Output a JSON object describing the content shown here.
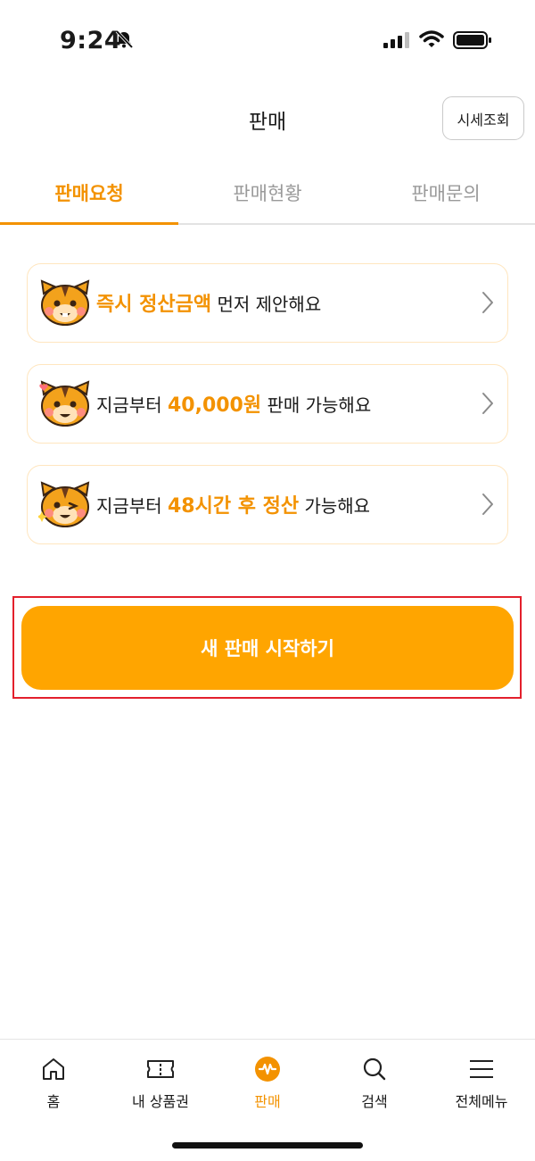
{
  "status_bar": {
    "time": "9:24"
  },
  "header": {
    "title": "판매",
    "price_check_label": "시세조회"
  },
  "tabs": [
    {
      "label": "판매요청",
      "active": true
    },
    {
      "label": "판매현황",
      "active": false
    },
    {
      "label": "판매문의",
      "active": false
    }
  ],
  "cards": [
    {
      "highlight": "즉시 정산금액",
      "suffix": " 먼저 제안해요"
    },
    {
      "prefix": "지금부터 ",
      "highlight": "40,000원",
      "suffix": " 판매 가능해요"
    },
    {
      "prefix": "지금부터 ",
      "highlight": "48시간 후 정산",
      "suffix": " 가능해요"
    }
  ],
  "cta": {
    "label": "새 판매 시작하기"
  },
  "bottom_nav": [
    {
      "label": "홈",
      "icon": "home-icon"
    },
    {
      "label": "내 상품권",
      "icon": "ticket-icon"
    },
    {
      "label": "판매",
      "icon": "sell-icon",
      "active": true
    },
    {
      "label": "검색",
      "icon": "search-icon"
    },
    {
      "label": "전체메뉴",
      "icon": "menu-icon"
    }
  ],
  "colors": {
    "accent": "#f39200",
    "cta": "#ffa500",
    "card_border": "#ffe6bf",
    "highlight_box": "#e3202c"
  }
}
